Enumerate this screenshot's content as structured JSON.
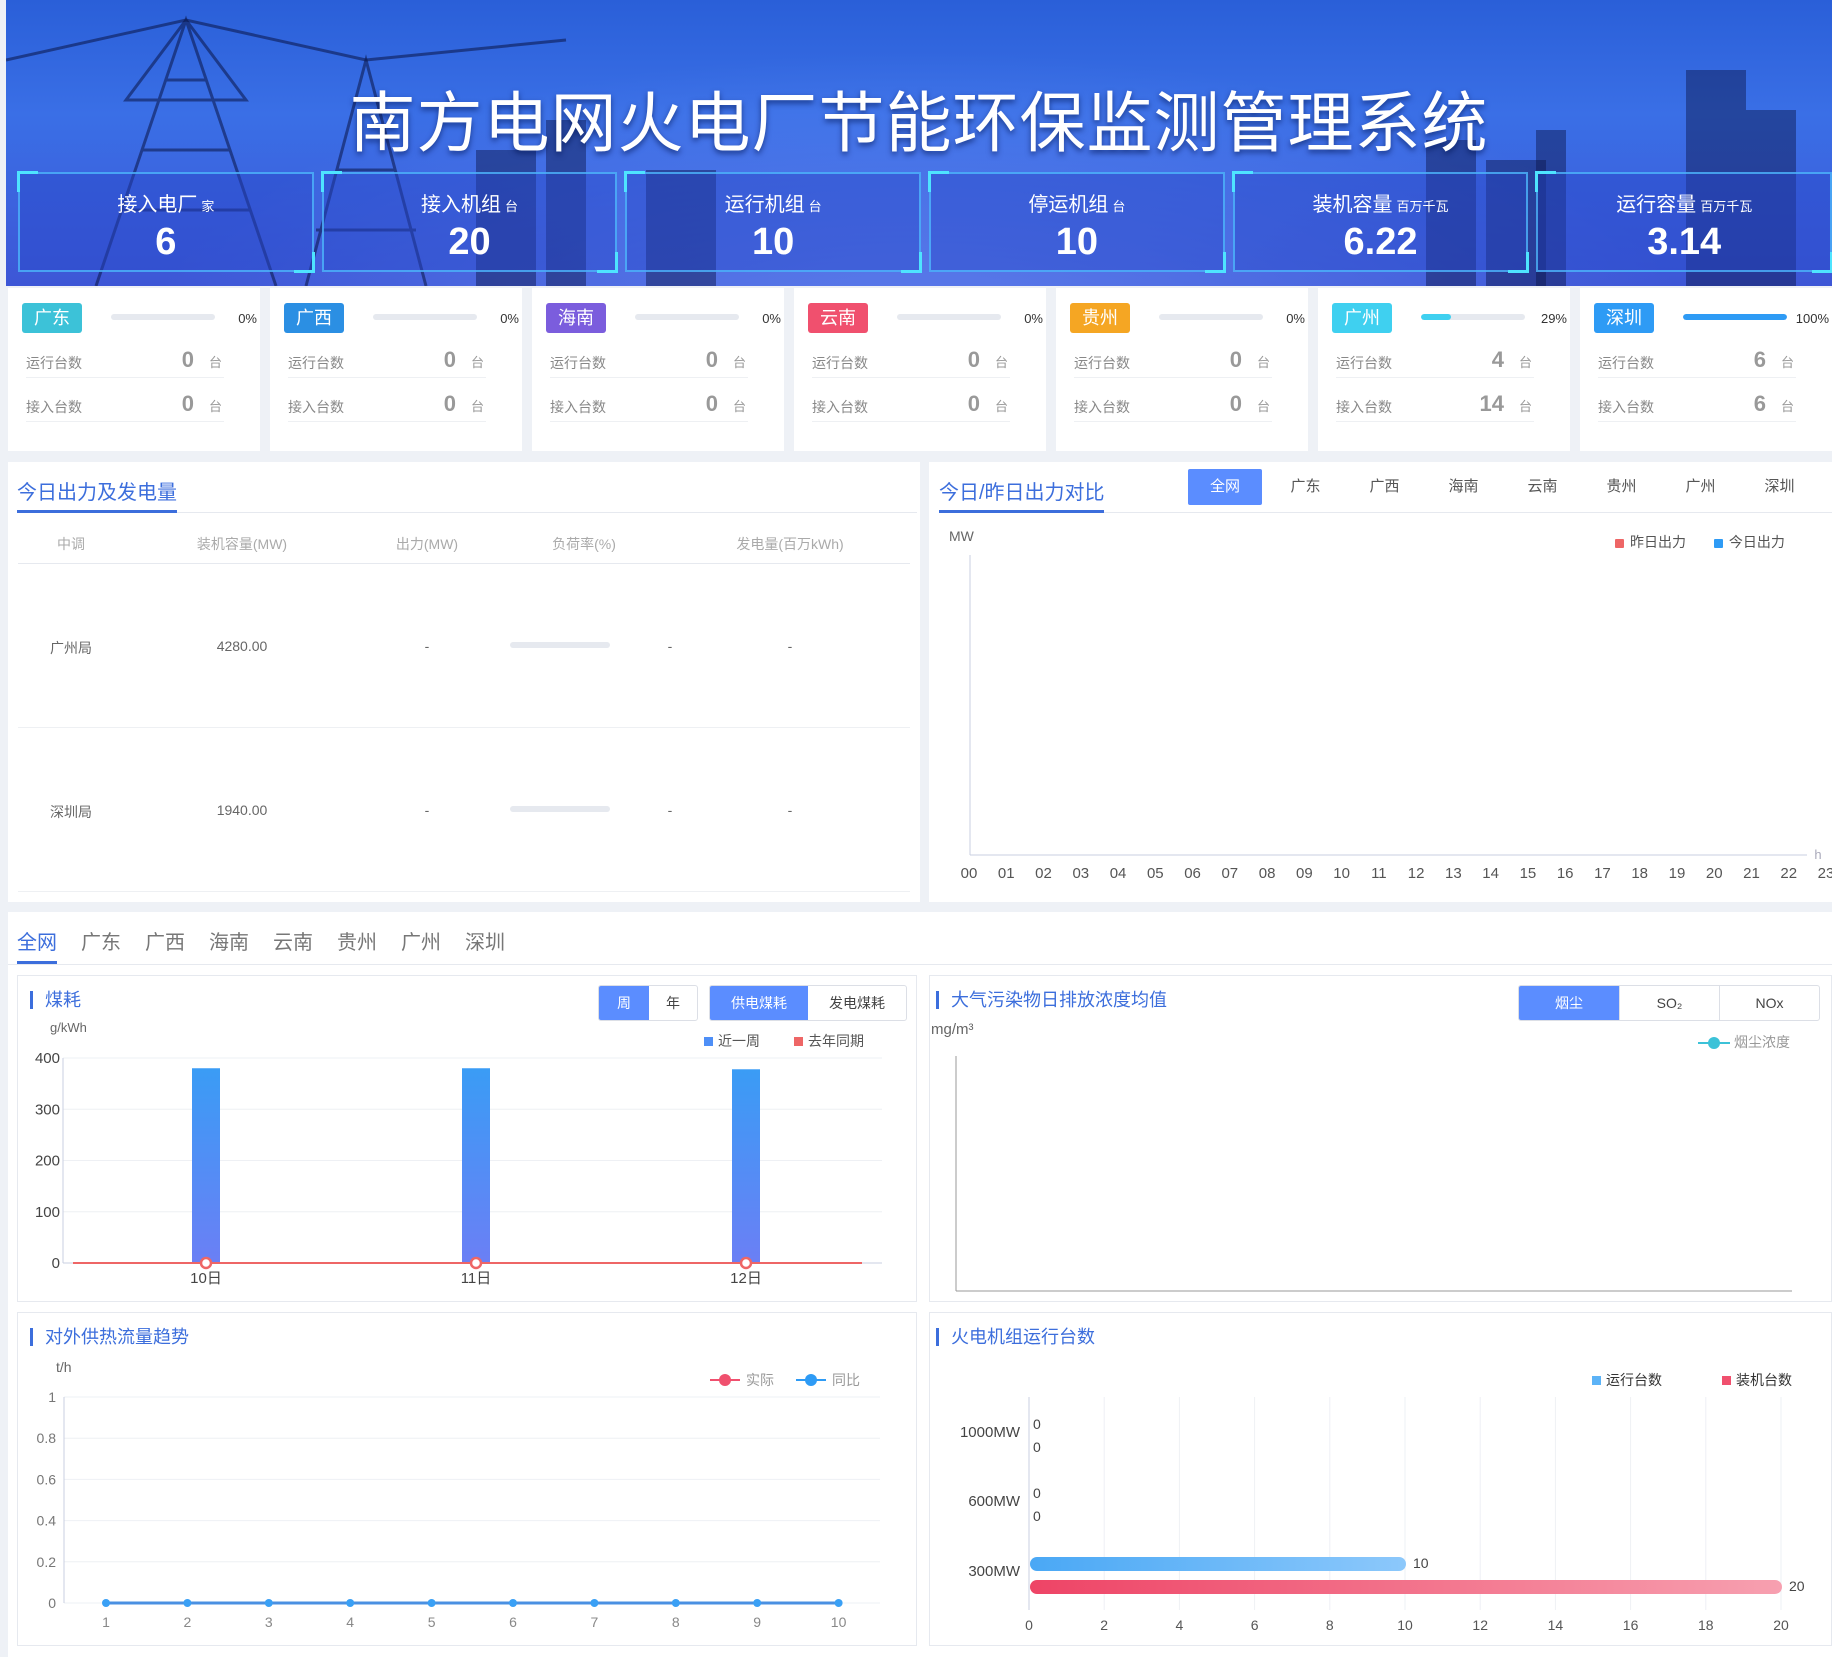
{
  "header": {
    "title": "南方电网火电厂节能环保监测管理系统"
  },
  "kpis": [
    {
      "label": "接入电厂",
      "unit": "家",
      "value": "6"
    },
    {
      "label": "接入机组",
      "unit": "台",
      "value": "20"
    },
    {
      "label": "运行机组",
      "unit": "台",
      "value": "10"
    },
    {
      "label": "停运机组",
      "unit": "台",
      "value": "10"
    },
    {
      "label": "装机容量",
      "unit": "百万千瓦",
      "value": "6.22"
    },
    {
      "label": "运行容量",
      "unit": "百万千瓦",
      "value": "3.14"
    }
  ],
  "region_labels": {
    "running": "运行台数",
    "connected": "接入台数",
    "unit": "台"
  },
  "regions": [
    {
      "name": "广东",
      "color": "#3cc2d8",
      "pct_text": "0%",
      "progress": 0,
      "running": "0",
      "connected": "0"
    },
    {
      "name": "广西",
      "color": "#2b8fe3",
      "pct_text": "0%",
      "progress": 0,
      "running": "0",
      "connected": "0"
    },
    {
      "name": "海南",
      "color": "#7b5ddd",
      "pct_text": "0%",
      "progress": 0,
      "running": "0",
      "connected": "0"
    },
    {
      "name": "云南",
      "color": "#f0506e",
      "pct_text": "0%",
      "progress": 0,
      "running": "0",
      "connected": "0"
    },
    {
      "name": "贵州",
      "color": "#f5a623",
      "pct_text": "0%",
      "progress": 0,
      "running": "0",
      "connected": "0"
    },
    {
      "name": "广州",
      "color": "#3fd0f0",
      "pct_text": "29%",
      "progress": 0.29,
      "running": "4",
      "connected": "14"
    },
    {
      "name": "深圳",
      "color": "#2e9bf5",
      "pct_text": "100%",
      "progress": 1.0,
      "running": "6",
      "connected": "6"
    }
  ],
  "today_output": {
    "title": "今日出力及发电量",
    "columns": [
      "中调",
      "装机容量(MW)",
      "出力(MW)",
      "负荷率(%)",
      "发电量(百万kWh)"
    ],
    "rows": [
      {
        "name": "广州局",
        "capacity": "4280.00",
        "output": "-",
        "load": "-",
        "gen": "-"
      },
      {
        "name": "深圳局",
        "capacity": "1940.00",
        "output": "-",
        "load": "-",
        "gen": "-"
      }
    ]
  },
  "compare": {
    "title": "今日/昨日出力对比",
    "tabs": [
      "全网",
      "广东",
      "广西",
      "海南",
      "云南",
      "贵州",
      "广州",
      "深圳"
    ],
    "active_tab": "全网",
    "y_unit": "MW",
    "x_unit": "h",
    "legend": [
      {
        "name": "昨日出力",
        "color": "#ee6666"
      },
      {
        "name": "今日出力",
        "color": "#2e9bf5"
      }
    ],
    "hours": [
      "00",
      "01",
      "02",
      "03",
      "04",
      "05",
      "06",
      "07",
      "08",
      "09",
      "10",
      "11",
      "12",
      "13",
      "14",
      "15",
      "16",
      "17",
      "18",
      "19",
      "20",
      "21",
      "22",
      "23"
    ]
  },
  "bottom_tabs": {
    "items": [
      "全网",
      "广东",
      "广西",
      "海南",
      "云南",
      "贵州",
      "广州",
      "深圳"
    ],
    "active": "全网"
  },
  "coal": {
    "title": "煤耗",
    "period_buttons": [
      "周",
      "年"
    ],
    "type_buttons": [
      "供电煤耗",
      "发电煤耗"
    ],
    "y_unit": "g/kWh"
  },
  "pollution": {
    "title": "大气污染物日排放浓度均值",
    "buttons": [
      "烟尘",
      "SO₂",
      "NOx"
    ],
    "y_unit": "mg/m³",
    "legend": "烟尘浓度"
  },
  "heat": {
    "title": "对外供热流量趋势",
    "y_unit": "t/h"
  },
  "units": {
    "title": "火电机组运行台数"
  },
  "chart_data": [
    {
      "type": "bar",
      "title": "煤耗",
      "ylabel": "g/kWh",
      "categories": [
        "10日",
        "11日",
        "12日"
      ],
      "ylim": [
        0,
        400
      ],
      "yticks": [
        0,
        100,
        200,
        300,
        400
      ],
      "series": [
        {
          "name": "近一周",
          "kind": "bar",
          "color": "#4e8ff7",
          "values": [
            380,
            380,
            378
          ]
        },
        {
          "name": "去年同期",
          "kind": "line",
          "color": "#ee6666",
          "values": [
            0,
            0,
            0
          ]
        }
      ]
    },
    {
      "type": "line",
      "title": "对外供热流量趋势",
      "ylabel": "t/h",
      "x": [
        1,
        2,
        3,
        4,
        5,
        6,
        7,
        8,
        9,
        10
      ],
      "ylim": [
        0,
        1
      ],
      "yticks": [
        "0",
        "0.2",
        "0.4",
        "0.6",
        "0.8",
        "1"
      ],
      "series": [
        {
          "name": "实际",
          "color": "#f0506e",
          "values": [
            0,
            0,
            0,
            0,
            0,
            0,
            0,
            0,
            0,
            0
          ]
        },
        {
          "name": "同比",
          "color": "#2e9bf5",
          "values": [
            0,
            0,
            0,
            0,
            0,
            0,
            0,
            0,
            0,
            0
          ]
        }
      ]
    },
    {
      "type": "bar",
      "orientation": "horizontal",
      "title": "火电机组运行台数",
      "categories": [
        "1000MW",
        "600MW",
        "300MW"
      ],
      "xlim": [
        0,
        20
      ],
      "xticks": [
        0,
        2,
        4,
        6,
        8,
        10,
        12,
        14,
        16,
        18,
        20
      ],
      "series": [
        {
          "name": "运行台数",
          "color": "#5cb3f7",
          "values": [
            0,
            0,
            10
          ]
        },
        {
          "name": "装机台数",
          "color": "#f0506e",
          "values": [
            0,
            0,
            20
          ]
        }
      ]
    }
  ]
}
